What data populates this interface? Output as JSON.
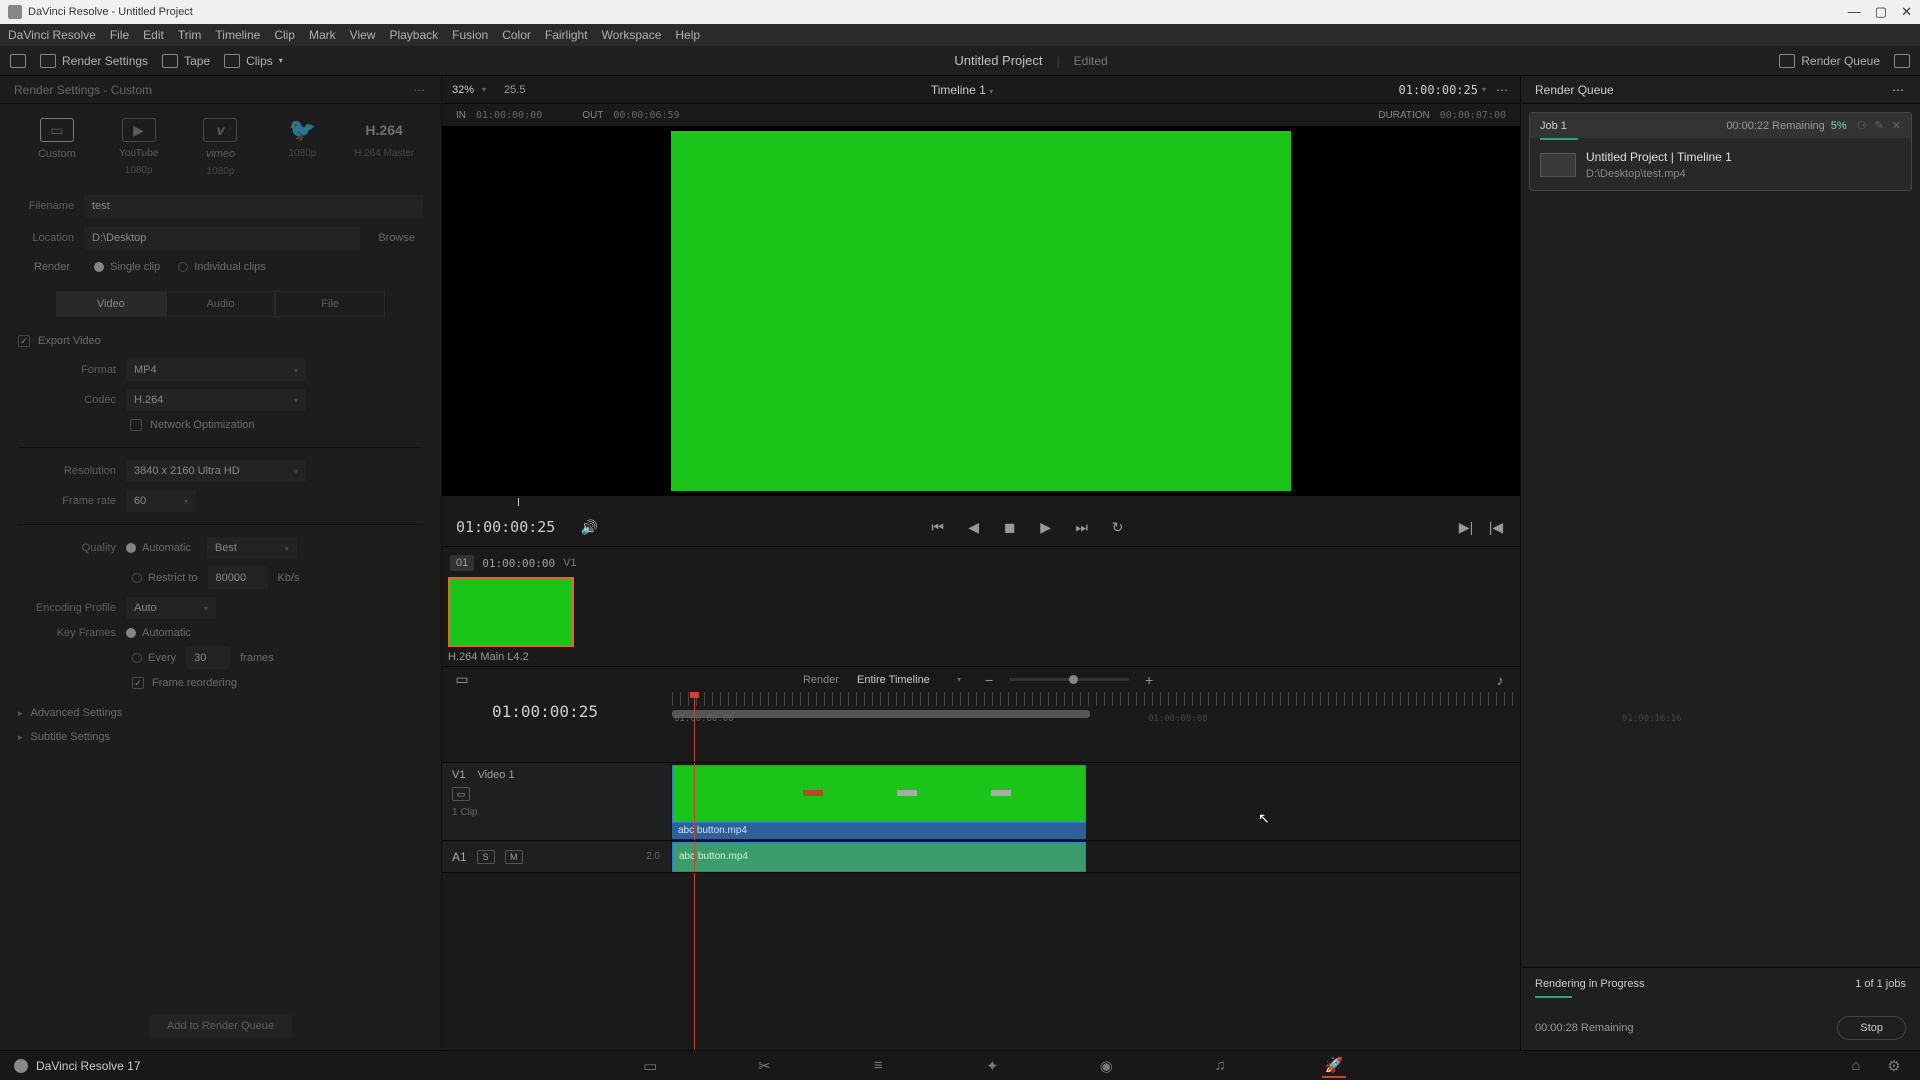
{
  "titlebar": {
    "title": "DaVinci Resolve - Untitled Project"
  },
  "menubar": [
    "DaVinci Resolve",
    "File",
    "Edit",
    "Trim",
    "Timeline",
    "Clip",
    "Mark",
    "View",
    "Playback",
    "Fusion",
    "Color",
    "Fairlight",
    "Workspace",
    "Help"
  ],
  "tabbar": {
    "render_settings": "Render Settings",
    "tape": "Tape",
    "clips": "Clips",
    "project": "Untitled Project",
    "status": "Edited",
    "render_queue": "Render Queue"
  },
  "left": {
    "header": "Render Settings - Custom",
    "presets": [
      {
        "icon": "film",
        "label": "Custom",
        "sub": ""
      },
      {
        "icon": "yt",
        "label": "YouTube",
        "sub": "1080p"
      },
      {
        "icon": "vimeo",
        "label": "vimeo",
        "sub": "1080p"
      },
      {
        "icon": "tw",
        "label": "",
        "sub": "1080p"
      },
      {
        "icon": "h264",
        "label": "H.264",
        "sub": "H.264 Master"
      }
    ],
    "filename_label": "Filename",
    "filename": "test",
    "location_label": "Location",
    "location": "D:\\Desktop",
    "browse": "Browse",
    "render_label": "Render",
    "single_clip": "Single clip",
    "individual_clips": "Individual clips",
    "tabs": {
      "video": "Video",
      "audio": "Audio",
      "file": "File"
    },
    "export_video": "Export Video",
    "format_label": "Format",
    "format": "MP4",
    "codec_label": "Codec",
    "codec": "H.264",
    "netopt": "Network Optimization",
    "resolution_label": "Resolution",
    "resolution": "3840 x 2160 Ultra HD",
    "framerate_label": "Frame rate",
    "framerate": "60",
    "quality_label": "Quality",
    "quality_auto": "Automatic",
    "quality_best": "Best",
    "restrict": "Restrict to",
    "restrict_val": "80000",
    "kbps": "Kb/s",
    "encprof_label": "Encoding Profile",
    "encprof": "Auto",
    "keyframes_label": "Key Frames",
    "keyframes_auto": "Automatic",
    "every": "Every",
    "every_val": "30",
    "frames": "frames",
    "reorder": "Frame reordering",
    "advanced": "Advanced Settings",
    "subtitle": "Subtitle Settings",
    "add_queue": "Add to Render Queue"
  },
  "viewer": {
    "zoom": "32%",
    "fps": "25.5",
    "timeline_name": "Timeline 1",
    "tc": "01:00:00:25",
    "in_label": "IN",
    "in_tc": "01:00:00:00",
    "out_label": "OUT",
    "out_tc": "00:00:06:59",
    "dur_label": "DURATION",
    "dur_tc": "00:00:07:00",
    "transport_tc": "01:00:00:25",
    "clip_num": "01",
    "clip_tc": "01:00:00:00",
    "clip_track": "V1",
    "clip_name": "H.264 Main L4.2"
  },
  "timeline": {
    "render_label": "Render",
    "render_scope": "Entire Timeline",
    "tc": "01:00:00:25",
    "ruler_tc": "01:00:00:00",
    "far_tc1": "01:00:08:08",
    "far_tc2": "01:00:16:16",
    "v1_id": "V1",
    "v1_name": "Video 1",
    "v1_count": "1 Clip",
    "a1_id": "A1",
    "a1_db": "2.0",
    "clip_name": "abc button.mp4"
  },
  "rq": {
    "header": "Render Queue",
    "job_name": "Job 1",
    "job_remain": "00:00:22 Remaining",
    "job_pct": "5%",
    "job_title": "Untitled Project | Timeline 1",
    "job_path": "D:\\Desktop\\test.mp4",
    "status": "Rendering in Progress",
    "jobs_count": "1 of 1 jobs",
    "remain": "00:00:28 Remaining",
    "stop": "Stop"
  },
  "bottom": {
    "app": "DaVinci Resolve 17"
  }
}
